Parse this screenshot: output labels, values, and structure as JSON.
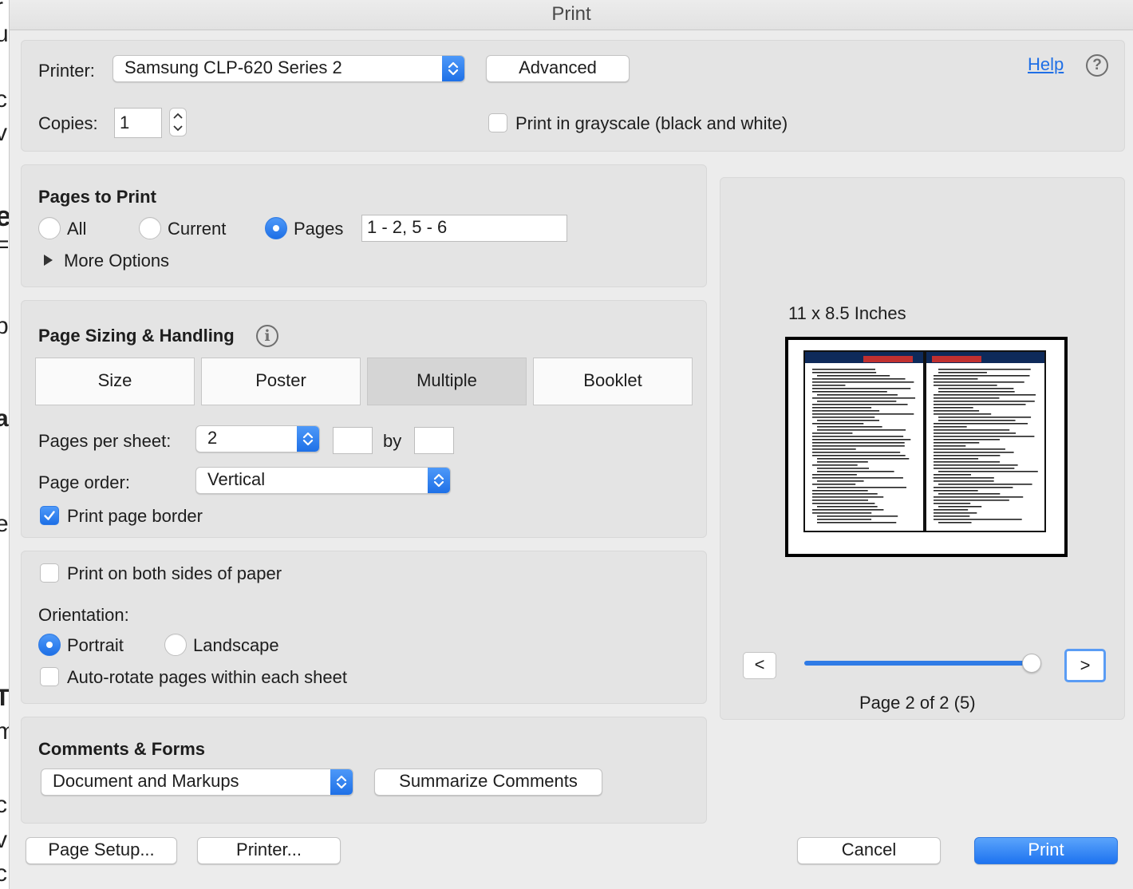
{
  "window": {
    "title": "Print"
  },
  "printer": {
    "label": "Printer:",
    "selected": "Samsung CLP-620 Series 2",
    "advanced_button": "Advanced",
    "help_link": "Help"
  },
  "copies": {
    "label": "Copies:",
    "value": "1"
  },
  "grayscale": {
    "label": "Print in grayscale (black and white)",
    "checked": false
  },
  "pages_to_print": {
    "heading": "Pages to Print",
    "options": [
      "All",
      "Current",
      "Pages"
    ],
    "selected": "Pages",
    "range_value": "1 - 2, 5 - 6",
    "more_options": "More Options"
  },
  "sizing": {
    "heading": "Page Sizing & Handling",
    "tabs": [
      "Size",
      "Poster",
      "Multiple",
      "Booklet"
    ],
    "active_tab": "Multiple",
    "pages_per_sheet_label": "Pages per sheet:",
    "pages_per_sheet_value": "2",
    "by_label": "by",
    "page_order_label": "Page order:",
    "page_order_value": "Vertical",
    "print_border_label": "Print page border",
    "print_border_checked": true
  },
  "duplex": {
    "both_sides_label": "Print on both sides of paper",
    "both_sides_checked": false,
    "orientation_label": "Orientation:",
    "orientations": [
      "Portrait",
      "Landscape"
    ],
    "orientation_selected": "Portrait",
    "auto_rotate_label": "Auto-rotate pages within each sheet",
    "auto_rotate_checked": false
  },
  "comments": {
    "heading": "Comments & Forms",
    "selected": "Document and Markups",
    "summarize_button": "Summarize Comments"
  },
  "preview": {
    "paper_size": "11 x 8.5 Inches",
    "prev_button": "<",
    "next_button": ">",
    "page_status": "Page 2 of 2 (5)",
    "slider_position": 1.0
  },
  "footer": {
    "page_setup": "Page Setup...",
    "printer": "Printer...",
    "cancel": "Cancel",
    "print": "Print"
  },
  "colors": {
    "accent": "#1f6fe6",
    "panel": "#e4e4e4",
    "background": "#ececec"
  }
}
